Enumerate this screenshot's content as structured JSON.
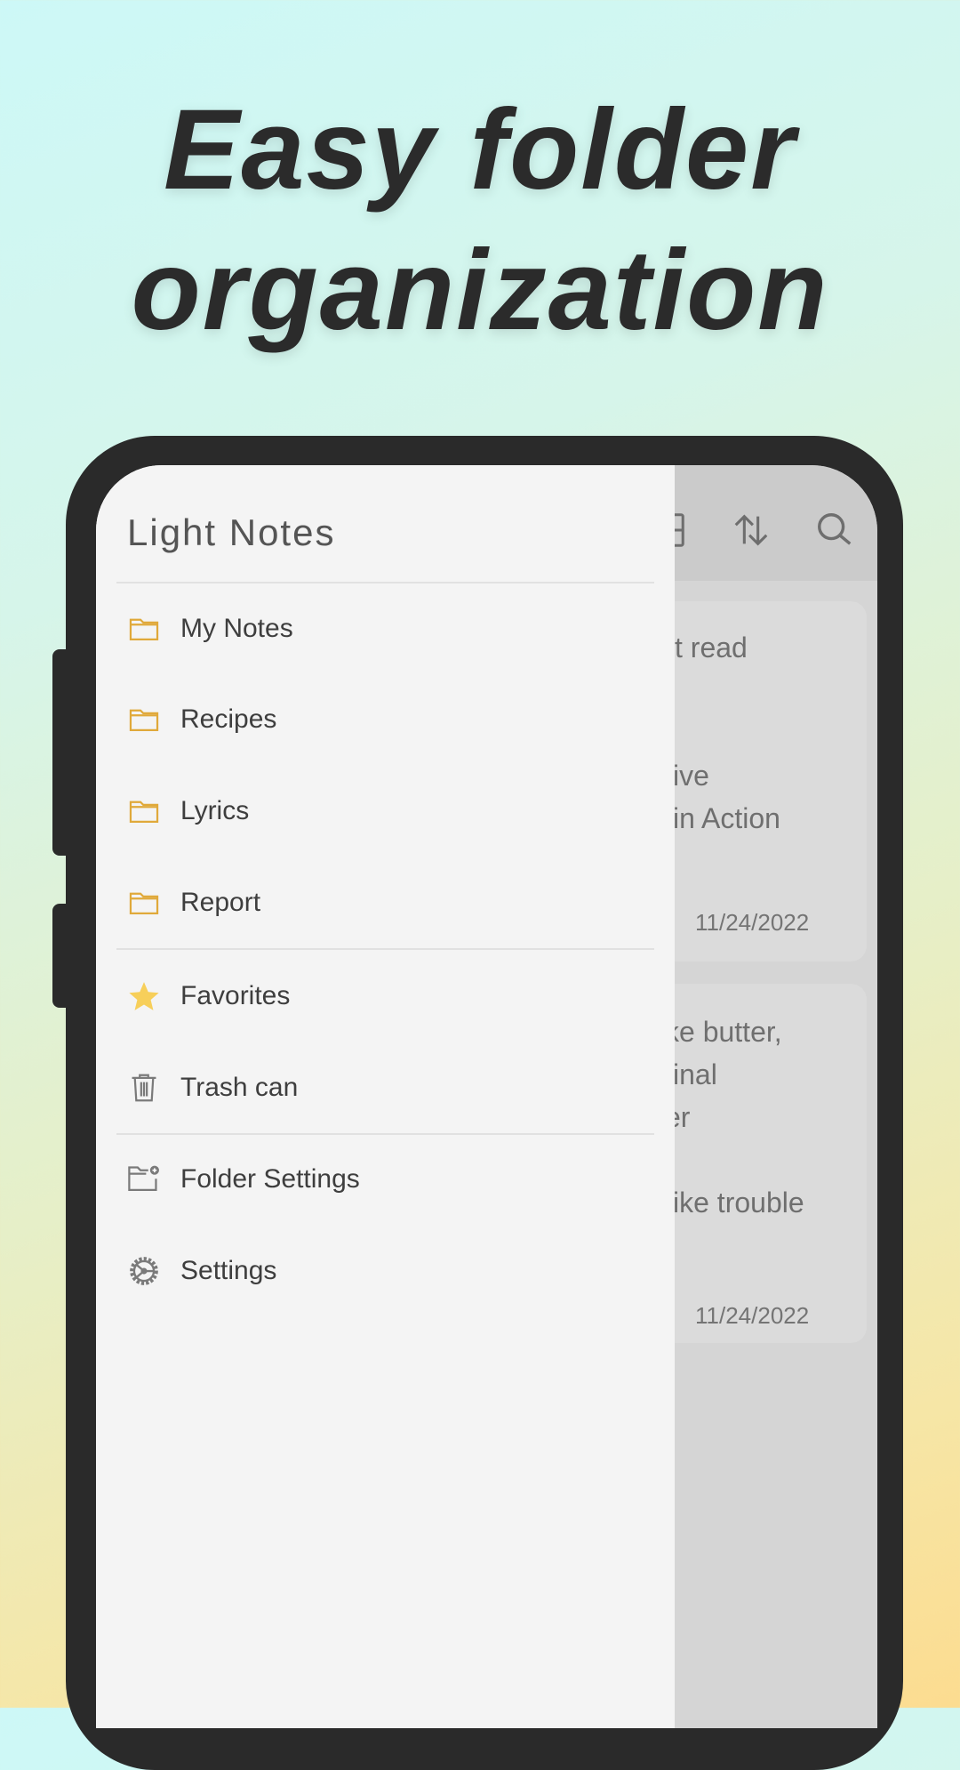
{
  "headline": {
    "line1": "Easy folder",
    "line2": "organization"
  },
  "app": {
    "title": "Light Notes",
    "icons": [
      "grid-view-icon",
      "sort-icon",
      "search-icon"
    ]
  },
  "drawer": {
    "folders": [
      {
        "label": "My Notes",
        "icon": "folder-icon"
      },
      {
        "label": "Recipes",
        "icon": "folder-icon"
      },
      {
        "label": "Lyrics",
        "icon": "folder-icon"
      },
      {
        "label": "Report",
        "icon": "folder-icon"
      }
    ],
    "special": [
      {
        "label": "Favorites",
        "icon": "star-icon"
      },
      {
        "label": "Trash can",
        "icon": "trash-icon"
      }
    ],
    "settings": [
      {
        "label": "Folder Settings",
        "icon": "folder-add-icon"
      },
      {
        "label": "Settings",
        "icon": "gear-icon"
      }
    ]
  },
  "notes": [
    {
      "lines": [
        "st read",
        "ive",
        "in Action"
      ],
      "date": "11/24/2022"
    },
    {
      "lines": [
        "ke butter,",
        "inal",
        "er",
        "ike trouble"
      ],
      "date": "11/24/2022"
    }
  ],
  "colors": {
    "folder": "#e0a93a",
    "star": "#f7cf5a",
    "frame": "#2a2a2a",
    "drawer": "#f4f4f4"
  }
}
